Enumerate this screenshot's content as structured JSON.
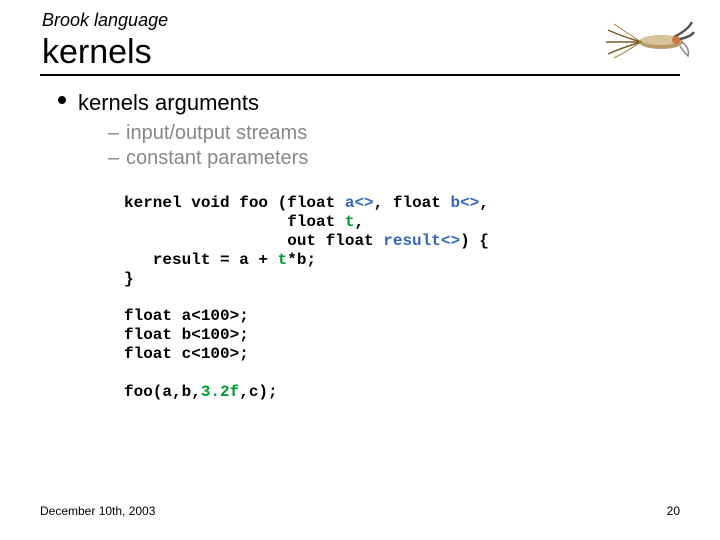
{
  "header": {
    "supertitle": "Brook language",
    "title": "kernels"
  },
  "bullet": "kernels arguments",
  "subs": [
    "input/output streams",
    "constant parameters"
  ],
  "code": {
    "l1a": "kernel void foo (float ",
    "l1b": "a<>",
    "l1c": ", float ",
    "l1d": "b<>",
    "l1e": ",",
    "l2a": "                 float ",
    "l2b": "t",
    "l2c": ",",
    "l3a": "                 out float ",
    "l3b": "result<>",
    "l3c": ") {",
    "l4a": "   result = a + ",
    "l4b": "t",
    "l4c": "*b;",
    "l5": "}",
    "blank1": "",
    "l6": "float a<100>;",
    "l7": "float b<100>;",
    "l8": "float c<100>;",
    "blank2": "",
    "l9a": "foo(a,b,",
    "l9b": "3.2f",
    "l9c": ",c);"
  },
  "footer": {
    "date": "December 10th, 2003",
    "page": "20"
  },
  "icon": {
    "name": "fly-fishing-lure"
  }
}
